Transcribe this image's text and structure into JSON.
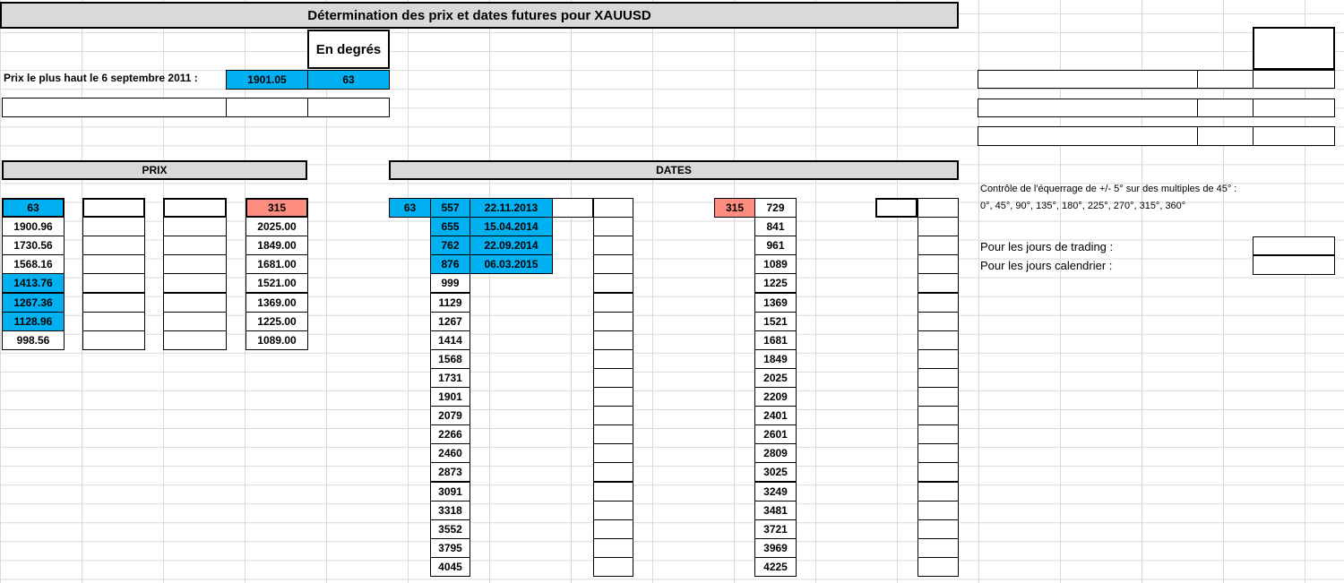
{
  "title": "Détermination des prix et dates futures pour XAUUSD",
  "header": {
    "degrees_label": "En degrés",
    "high_label": "Prix le plus haut le 6 septembre 2011 :",
    "high_price": "1901.05",
    "high_degrees": "63"
  },
  "prix": {
    "heading": "PRIX",
    "col1_head": "63",
    "col1": [
      "1900.96",
      "1730.56",
      "1568.16",
      "1413.76",
      "1267.36",
      "1128.96",
      "998.56"
    ],
    "col4_head": "315",
    "col4": [
      "2025.00",
      "1849.00",
      "1681.00",
      "1521.00",
      "1369.00",
      "1225.00",
      "1089.00"
    ]
  },
  "dates": {
    "heading": "DATES",
    "left_head": "63",
    "left_numbers": [
      "557",
      "655",
      "762",
      "876",
      "999",
      "1129",
      "1267",
      "1414",
      "1568",
      "1731",
      "1901",
      "2079",
      "2266",
      "2460",
      "2873",
      "3091",
      "3318",
      "3552",
      "3795",
      "4045"
    ],
    "left_dates": [
      "22.11.2013",
      "15.04.2014",
      "22.09.2014",
      "06.03.2015"
    ],
    "right_head": "315",
    "right_numbers": [
      "729",
      "841",
      "961",
      "1089",
      "1225",
      "1369",
      "1521",
      "1681",
      "1849",
      "2025",
      "2209",
      "2401",
      "2601",
      "2809",
      "3025",
      "3249",
      "3481",
      "3721",
      "3969",
      "4225"
    ]
  },
  "side": {
    "note_line1": "Contrôle de l'équerrage de +/- 5° sur des multiples de 45° :",
    "note_line2": "0°, 45°, 90°, 135°, 180°, 225°, 270°, 315°, 360°",
    "trading_label": "Pour les jours de trading :",
    "calendar_label": "Pour les jours calendrier :"
  }
}
